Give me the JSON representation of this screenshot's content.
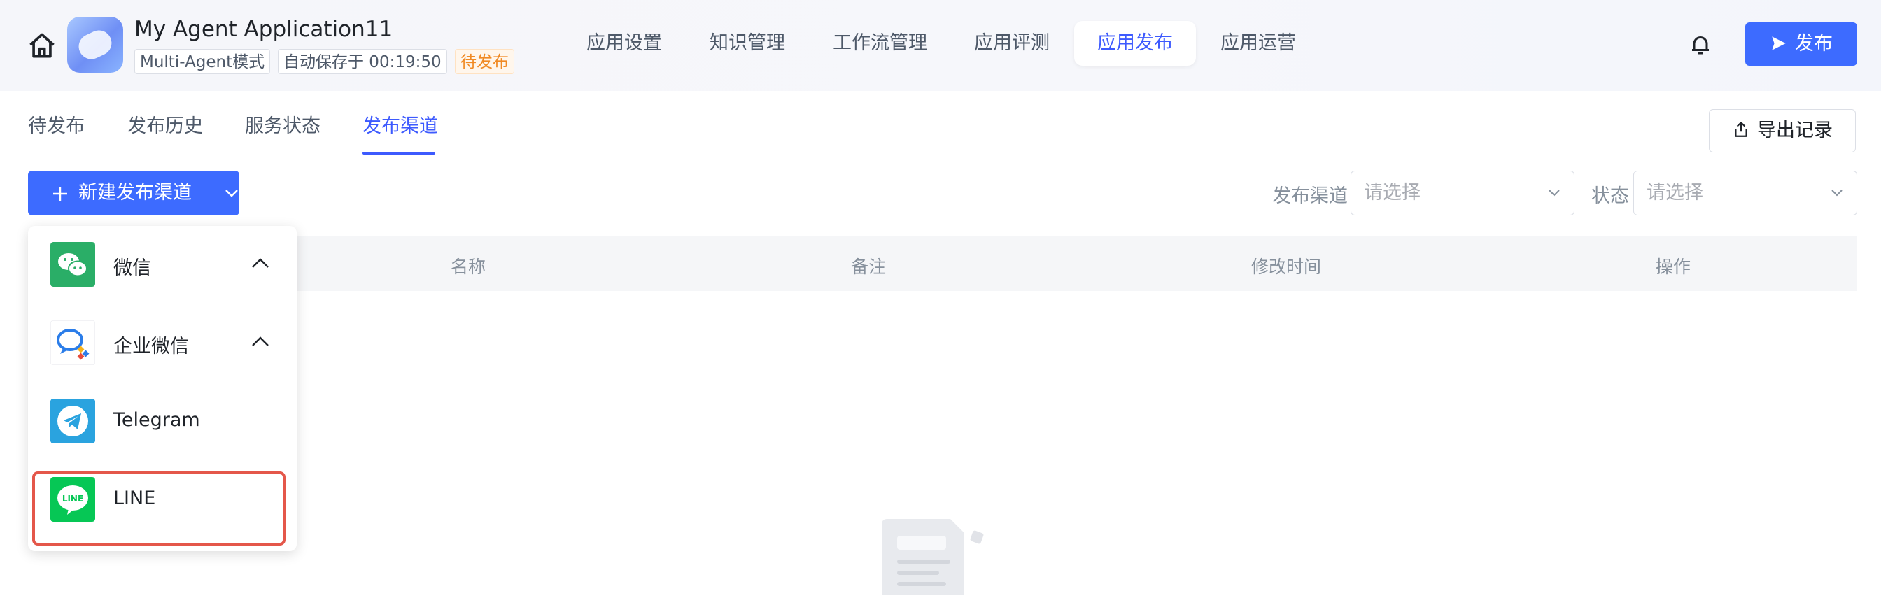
{
  "header": {
    "app_title": "My Agent Application11",
    "mode_tag": "Multi-Agent模式",
    "autosave_tag": "自动保存于 00:19:50",
    "status_tag": "待发布",
    "nav_tabs": [
      {
        "label": "应用设置"
      },
      {
        "label": "知识管理"
      },
      {
        "label": "工作流管理"
      },
      {
        "label": "应用评测"
      },
      {
        "label": "应用发布",
        "active": true
      },
      {
        "label": "应用运营"
      }
    ],
    "publish_label": "发布"
  },
  "subtabs": [
    {
      "label": "待发布"
    },
    {
      "label": "发布历史"
    },
    {
      "label": "服务状态"
    },
    {
      "label": "发布渠道",
      "active": true
    }
  ],
  "export_label": "导出记录",
  "new_channel_label": "新建发布渠道",
  "filters": {
    "channel_label": "发布渠道",
    "channel_placeholder": "请选择",
    "status_label": "状态",
    "status_placeholder": "请选择"
  },
  "table": {
    "columns": [
      "名称",
      "备注",
      "修改时间",
      "操作"
    ]
  },
  "dropdown": {
    "items": [
      {
        "label": "微信",
        "icon": "wechat-icon",
        "expandable": true
      },
      {
        "label": "企业微信",
        "icon": "wecom-icon",
        "expandable": true
      },
      {
        "label": "Telegram",
        "icon": "telegram-icon",
        "expandable": false
      },
      {
        "label": "LINE",
        "icon": "line-icon",
        "expandable": false,
        "highlighted": true
      }
    ]
  },
  "colors": {
    "accent": "#3d6bff",
    "active_text": "#3d5afe",
    "pending": "#f08a24",
    "highlight_border": "#e4574a",
    "wechat_green": "#2aae67",
    "line_green": "#06c755",
    "telegram_blue": "#2aa3df"
  }
}
